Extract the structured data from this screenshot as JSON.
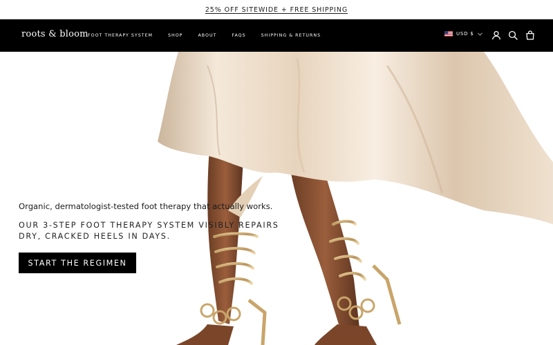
{
  "announcement": {
    "text": "25% OFF SITEWIDE + FREE SHIPPING"
  },
  "header": {
    "logo": "roots & bloom",
    "nav": [
      {
        "label": "FOOT THERAPY SYSTEM"
      },
      {
        "label": "SHOP"
      },
      {
        "label": "ABOUT"
      },
      {
        "label": "FAQS"
      },
      {
        "label": "SHIPPING & RETURNS"
      }
    ],
    "currency": {
      "label": "USD $",
      "flag": "us-flag-icon"
    },
    "icons": [
      "account-icon",
      "search-icon",
      "cart-icon"
    ]
  },
  "hero": {
    "image": "woman-in-satin-skirt-and-gold-strappy-heels",
    "tagline": "Organic, dermatologist-tested foot therapy that actually works.",
    "subhead": "OUR 3-STEP FOOT THERAPY SYSTEM VISIBLY REPAIRS DRY, CRACKED HEELS IN DAYS.",
    "cta": "START THE REGIMEN"
  },
  "colors": {
    "header_bg": "#000000",
    "cta_bg": "#000000",
    "page_bg": "#ffffff"
  }
}
